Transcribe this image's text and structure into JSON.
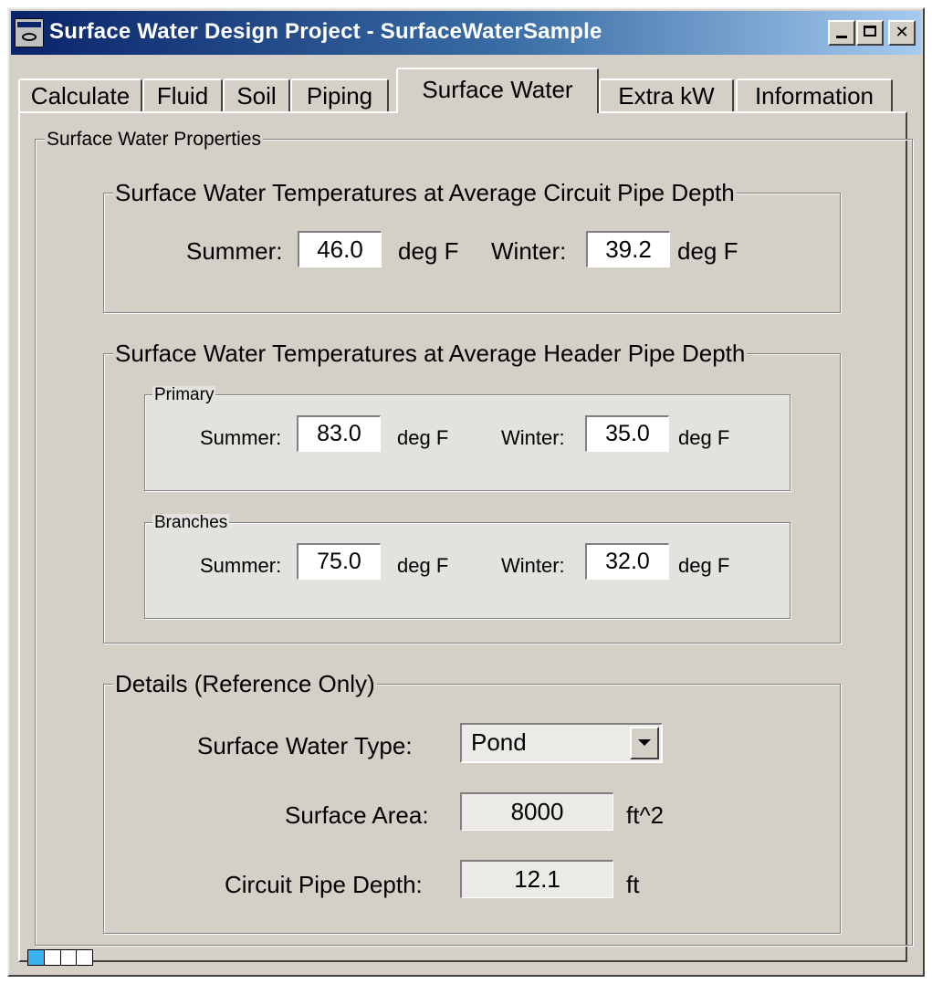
{
  "window": {
    "title": "Surface Water Design Project - SurfaceWaterSample",
    "controls": {
      "minimize": "_",
      "maximize": "□",
      "close": "✕"
    }
  },
  "tabs": [
    {
      "label": "Calculate",
      "active": false
    },
    {
      "label": "Fluid",
      "active": false
    },
    {
      "label": "Soil",
      "active": false
    },
    {
      "label": "Piping",
      "active": false
    },
    {
      "label": "Surface Water",
      "active": true
    },
    {
      "label": "Extra kW",
      "active": false
    },
    {
      "label": "Information",
      "active": false
    }
  ],
  "panel": {
    "title": "Surface Water Properties",
    "circuit": {
      "title": "Surface Water Temperatures at Average Circuit Pipe Depth",
      "summer_label": "Summer:",
      "summer_value": "46.0",
      "summer_unit": "deg F",
      "winter_label": "Winter:",
      "winter_value": "39.2",
      "winter_unit": "deg F"
    },
    "header": {
      "title": "Surface Water Temperatures at Average Header Pipe Depth",
      "primary": {
        "title": "Primary",
        "summer_label": "Summer:",
        "summer_value": "83.0",
        "summer_unit": "deg F",
        "winter_label": "Winter:",
        "winter_value": "35.0",
        "winter_unit": "deg F"
      },
      "branches": {
        "title": "Branches",
        "summer_label": "Summer:",
        "summer_value": "75.0",
        "summer_unit": "deg F",
        "winter_label": "Winter:",
        "winter_value": "32.0",
        "winter_unit": "deg F"
      }
    },
    "details": {
      "title": "Details (Reference Only)",
      "type_label": "Surface Water Type:",
      "type_value": "Pond",
      "area_label": "Surface Area:",
      "area_value": "8000",
      "area_unit": "ft^2",
      "depth_label": "Circuit Pipe Depth:",
      "depth_value": "12.1",
      "depth_unit": "ft"
    }
  },
  "status": {
    "segments_total": 4,
    "segments_filled": 1
  },
  "colors": {
    "face": "#d4d0c8",
    "title_start": "#0a246a",
    "title_end": "#a6caf0",
    "progress": "#3ab4ef"
  }
}
